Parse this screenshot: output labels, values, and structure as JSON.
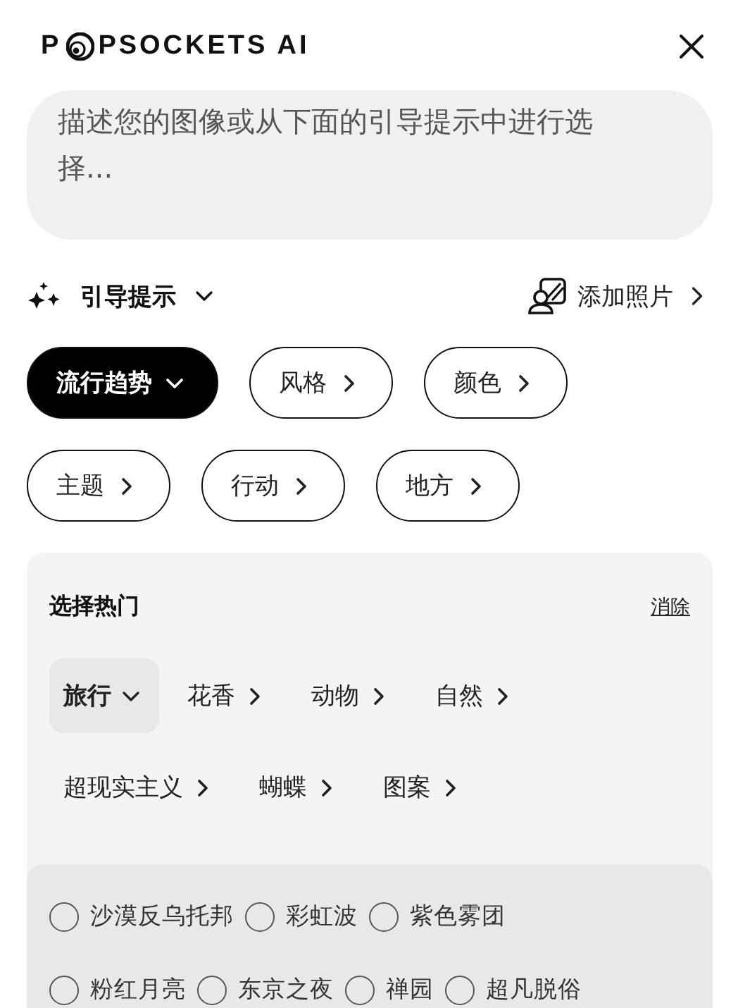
{
  "logo": {
    "before": "P",
    "after": "PSOCKETS AI"
  },
  "prompt": {
    "placeholder": "描述您的图像或从下面的引导提示中进行选择..."
  },
  "guide": {
    "label": "引导提示",
    "expanded": true
  },
  "add_photo": {
    "label": "添加照片"
  },
  "chips": [
    {
      "label": "流行趋势",
      "selected": true
    },
    {
      "label": "风格",
      "selected": false
    },
    {
      "label": "颜色",
      "selected": false
    },
    {
      "label": "主题",
      "selected": false
    },
    {
      "label": "行动",
      "selected": false
    },
    {
      "label": "地方",
      "selected": false
    }
  ],
  "panel": {
    "title": "选择热门",
    "clear": "消除",
    "categories": [
      {
        "label": "旅行",
        "selected": true
      },
      {
        "label": "花香",
        "selected": false
      },
      {
        "label": "动物",
        "selected": false
      },
      {
        "label": "自然",
        "selected": false
      },
      {
        "label": "超现实主义",
        "selected": false
      },
      {
        "label": "蝴蝶",
        "selected": false
      },
      {
        "label": "图案",
        "selected": false
      }
    ],
    "options": [
      {
        "label": "沙漠反乌托邦",
        "selected": false
      },
      {
        "label": "彩虹波",
        "selected": false
      },
      {
        "label": "紫色雾团",
        "selected": false
      },
      {
        "label": "粉红月亮",
        "selected": false
      },
      {
        "label": "东京之夜",
        "selected": false
      },
      {
        "label": "禅园",
        "selected": false
      },
      {
        "label": "超凡脱俗",
        "selected": false
      }
    ]
  }
}
